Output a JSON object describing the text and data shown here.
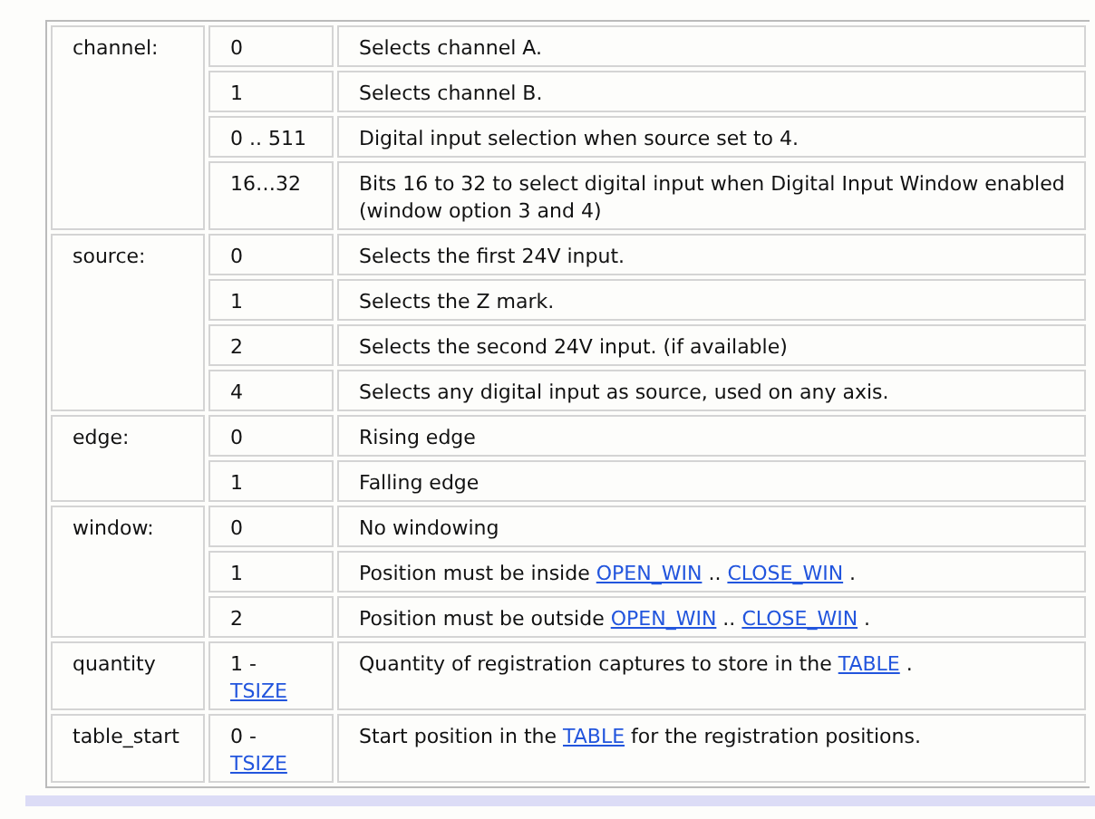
{
  "parameters": [
    {
      "name": "channel:",
      "options": [
        {
          "value": [
            {
              "text": "0"
            }
          ],
          "description": [
            {
              "text": "Selects channel A."
            }
          ]
        },
        {
          "value": [
            {
              "text": "1"
            }
          ],
          "description": [
            {
              "text": "Selects channel B."
            }
          ]
        },
        {
          "value": [
            {
              "text": "0 .. 511"
            }
          ],
          "description": [
            {
              "text": "Digital input selection when source set to 4."
            }
          ]
        },
        {
          "value": [
            {
              "text": "16…32"
            }
          ],
          "description": [
            {
              "text": "Bits 16 to 32 to select digital input when Digital Input Window enabled (window option 3 and 4)"
            }
          ]
        }
      ]
    },
    {
      "name": "source:",
      "options": [
        {
          "value": [
            {
              "text": "0"
            }
          ],
          "description": [
            {
              "text": "Selects the first 24V input."
            }
          ]
        },
        {
          "value": [
            {
              "text": "1"
            }
          ],
          "description": [
            {
              "text": "Selects the Z mark."
            }
          ]
        },
        {
          "value": [
            {
              "text": "2"
            }
          ],
          "description": [
            {
              "text": "Selects the second 24V input. (if available)"
            }
          ]
        },
        {
          "value": [
            {
              "text": "4"
            }
          ],
          "description": [
            {
              "text": "Selects any digital input as source, used on any axis."
            }
          ]
        }
      ]
    },
    {
      "name": "edge:",
      "options": [
        {
          "value": [
            {
              "text": "0"
            }
          ],
          "description": [
            {
              "text": "Rising edge"
            }
          ]
        },
        {
          "value": [
            {
              "text": "1"
            }
          ],
          "description": [
            {
              "text": "Falling edge"
            }
          ]
        }
      ]
    },
    {
      "name": "window:",
      "options": [
        {
          "value": [
            {
              "text": "0"
            }
          ],
          "description": [
            {
              "text": "No windowing"
            }
          ]
        },
        {
          "value": [
            {
              "text": "1"
            }
          ],
          "description": [
            {
              "text": "Position must be inside "
            },
            {
              "text": "OPEN_WIN",
              "link": true
            },
            {
              "text": " .. "
            },
            {
              "text": "CLOSE_WIN",
              "link": true
            },
            {
              "text": " ."
            }
          ]
        },
        {
          "value": [
            {
              "text": "2"
            }
          ],
          "description": [
            {
              "text": "Position must be outside "
            },
            {
              "text": "OPEN_WIN",
              "link": true
            },
            {
              "text": " .. "
            },
            {
              "text": "CLOSE_WIN",
              "link": true
            },
            {
              "text": " ."
            }
          ]
        }
      ]
    },
    {
      "name": "quantity",
      "options": [
        {
          "value": [
            {
              "text": "1 - "
            },
            {
              "text": "TSIZE",
              "link": true
            }
          ],
          "description": [
            {
              "text": "Quantity of registration captures to store in the "
            },
            {
              "text": "TABLE",
              "link": true
            },
            {
              "text": " ."
            }
          ]
        }
      ]
    },
    {
      "name": "table_start",
      "options": [
        {
          "value": [
            {
              "text": "0 - "
            },
            {
              "text": "TSIZE",
              "link": true
            }
          ],
          "description": [
            {
              "text": "Start position in the "
            },
            {
              "text": "TABLE",
              "link": true
            },
            {
              "text": " for the registration positions."
            }
          ]
        }
      ]
    }
  ]
}
